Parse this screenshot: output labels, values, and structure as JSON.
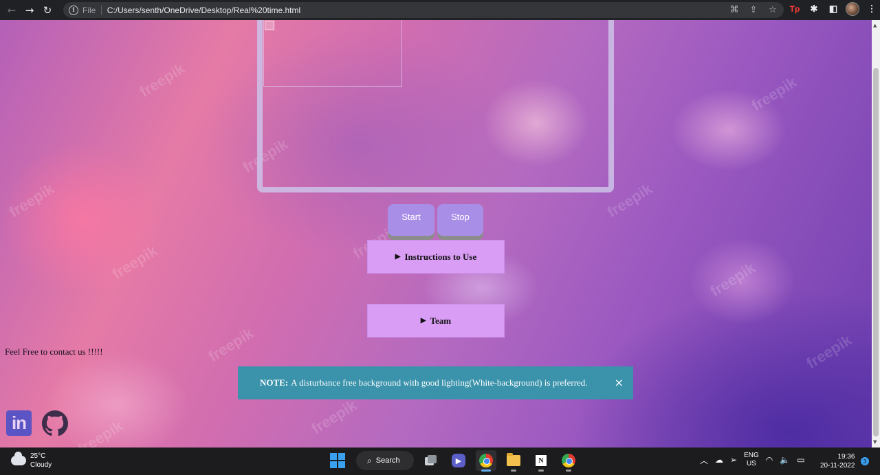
{
  "browser": {
    "back_icon": "arrow-left",
    "forward_icon": "arrow-right",
    "reload_icon": "reload",
    "scheme_label": "File",
    "url": "C:/Users/senth/OneDrive/Desktop/Real%20time.html",
    "extension_tp_label": "Tp"
  },
  "page": {
    "start_label": "Start",
    "stop_label": "Stop",
    "instructions_label": "Instructions to Use",
    "team_label": "Team",
    "contact_text": "Feel Free to contact us !!!!!",
    "note_bold": "NOTE:",
    "note_text": "A disturbance free background with good lighting(White-background) is preferred.",
    "note_close": "×",
    "linkedin_label": "in",
    "watermark": "freepik",
    "colors": {
      "button_bg": "#a98ee8",
      "details_bg": "#d99df5",
      "note_bg": "#3a92ab"
    }
  },
  "taskbar": {
    "temperature": "25°C",
    "condition": "Cloudy",
    "search_label": "Search",
    "lang_line1": "ENG",
    "lang_line2": "US",
    "time": "19:36",
    "date": "20-11-2022",
    "notification_count": "3"
  }
}
